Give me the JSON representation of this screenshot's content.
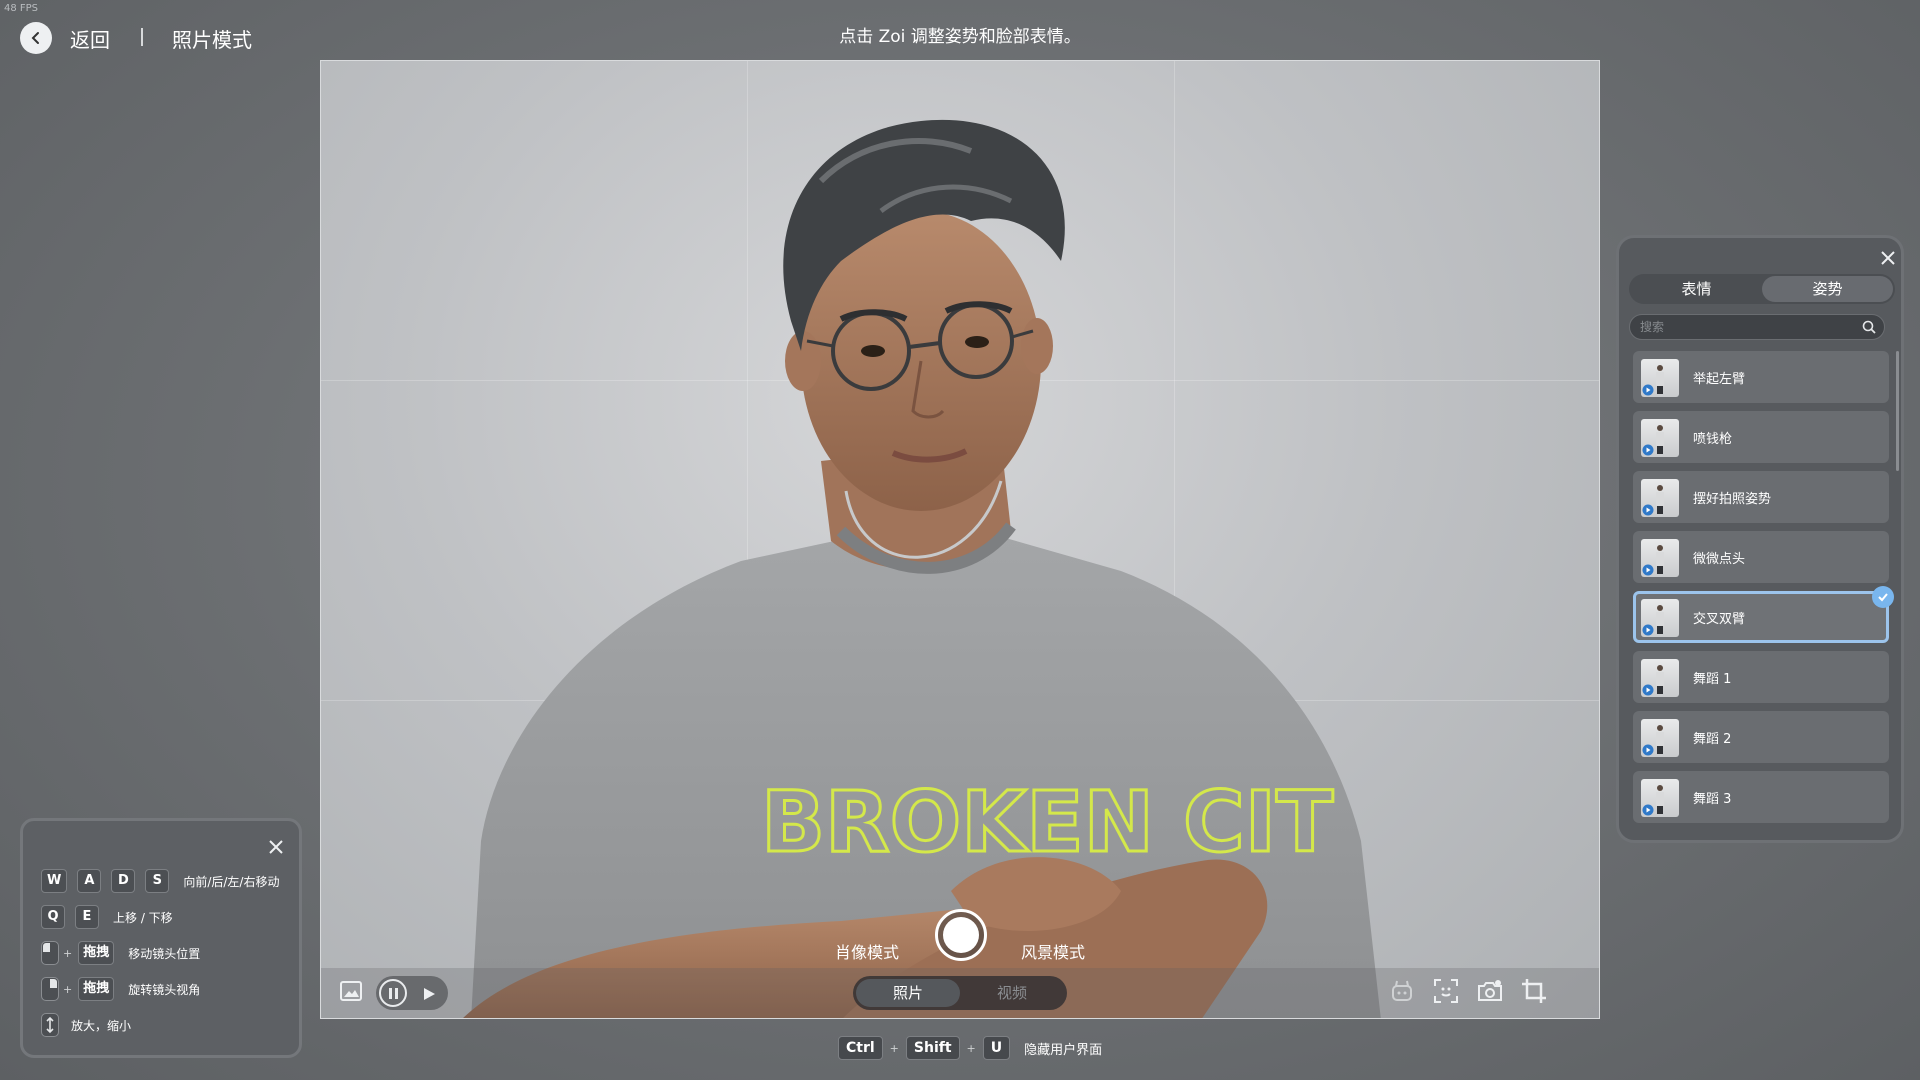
{
  "fps": "48 FPS",
  "topbar": {
    "back_label": "返回",
    "mode_title": "照片模式",
    "hint": "点击 Zoi 调整姿势和脸部表情。"
  },
  "viewport": {
    "shirt_text": "BROKEN CIT",
    "mode_left": "肖像模式",
    "mode_right": "风景模式",
    "segment": {
      "photo": "照片",
      "video": "视频"
    }
  },
  "right_panel": {
    "tabs": [
      "表情",
      "姿势"
    ],
    "active_tab": "姿势",
    "search_placeholder": "搜索",
    "items": [
      {
        "label": "举起左臂"
      },
      {
        "label": "喷钱枪"
      },
      {
        "label": "摆好拍照姿势"
      },
      {
        "label": "微微点头"
      },
      {
        "label": "交叉双臂",
        "selected": true
      },
      {
        "label": "舞蹈 1"
      },
      {
        "label": "舞蹈 2"
      },
      {
        "label": "舞蹈 3"
      }
    ]
  },
  "help_panel": {
    "keys_move": [
      "W",
      "A",
      "D",
      "S"
    ],
    "move_text": "向前/后/左/右移动",
    "keys_updown": [
      "Q",
      "E"
    ],
    "updown_text": "上移 / 下移",
    "drag_label": "拖拽",
    "plus": "+",
    "move_cam_text": "移动镜头位置",
    "rotate_cam_text": "旋转镜头视角",
    "zoom_text": "放大，缩小"
  },
  "shortcut": {
    "keys": [
      "Ctrl",
      "Shift",
      "U"
    ],
    "plus": "+",
    "text": "隐藏用户界面"
  },
  "colors": {
    "accent": "#79b6ee",
    "selection_border": "#9cc4ec",
    "shirt_print": "#d4e84a"
  }
}
